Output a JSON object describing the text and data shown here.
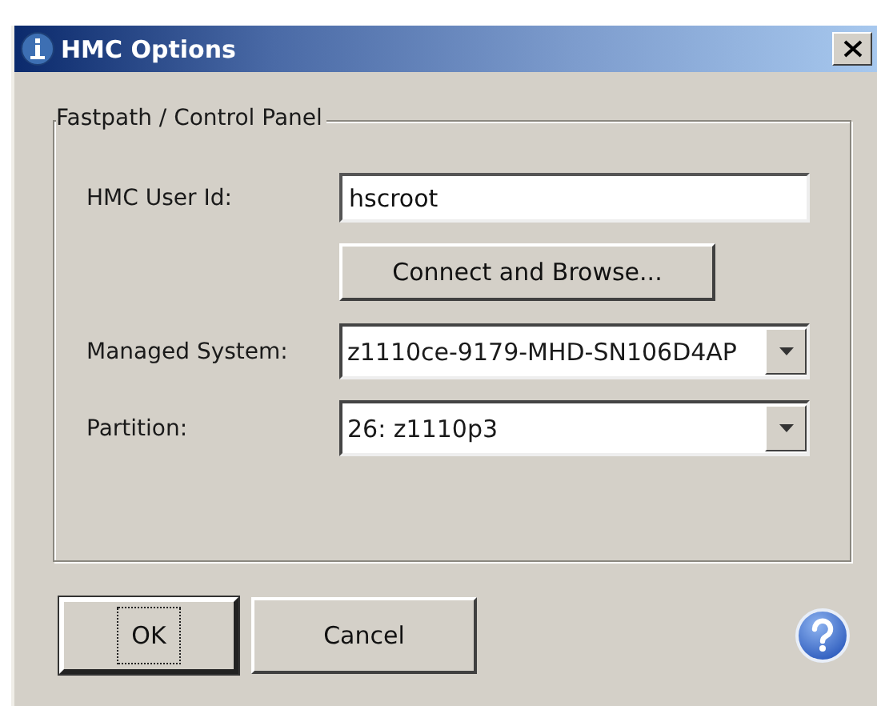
{
  "window": {
    "title": "HMC Options"
  },
  "group": {
    "title": "Fastpath / Control Panel",
    "user_id": {
      "label": "HMC User Id:",
      "value": "hscroot"
    },
    "connect_button": "Connect and Browse...",
    "combos": [
      {
        "label": "Managed System:",
        "value": "z1110ce-9179-MHD-SN106D4AP"
      },
      {
        "label": "Partition:",
        "value": "26: z1110p3"
      }
    ]
  },
  "buttons": [
    {
      "label": "OK",
      "default": true
    },
    {
      "label": "Cancel",
      "default": false
    }
  ]
}
